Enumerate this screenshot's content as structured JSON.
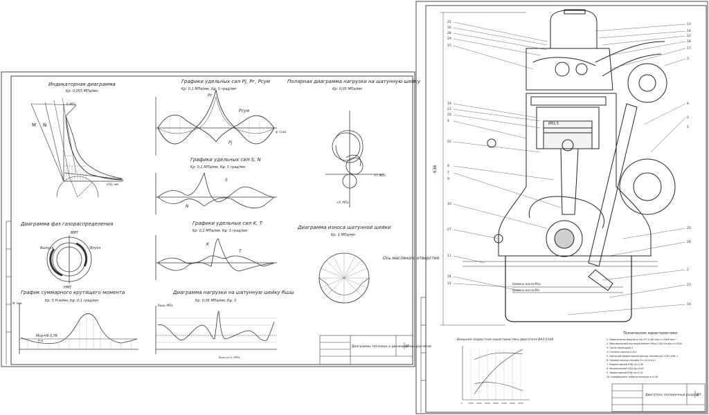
{
  "left_sheet": {
    "titles": {
      "indicator": "Индикаторная диаграмма",
      "forces_pj": "Графики удельных сил Pj, Pг, Pсум",
      "polar": "Полярная диаграмма нагрузки на шатунную шейку",
      "forces_sn": "Графики удельных сил S, N",
      "valve_timing": "Диаграмма фаз газораспределения",
      "forces_kt": "Графики удельных сил K, T",
      "wear": "Диаграмма износа шатунной шейки",
      "torque": "График суммарного крутящего момента",
      "rsh": "Диаграмма нагрузки на шатунную шейку Rшш"
    },
    "scales": {
      "indicator": "Kp: 0,055 МПа/мм",
      "forces_pj": "Kp: 0,1 МПа/мм, Kφ: 3 град/мм",
      "polar": "Kp: 0,05 МПа/мм",
      "forces_sn": "Kp: 0,1 МПа/мм, Kφ: 3 град/мм",
      "forces_kt": "Kp: 0,1 МПа/мм, Kφ: 3 град/мм",
      "wear": "Kp: 1 МПа/мм",
      "torque": "Kp: 5 Н·м/мм, Kφ: 0,1 град/мм",
      "rsh": "Kp: 0,05 МПа/мм, Kφ: 3"
    },
    "labels": {
      "m": "M",
      "n": "N",
      "p_mpa": "P, МПа",
      "v_cm": "V(S), мм",
      "pg": "Pг",
      "psum": "Pсум",
      "pj": "Pj",
      "phi_deg": "φ, град",
      "s": "S",
      "n2": "N",
      "k": "K",
      "t": "T",
      "vmt": "ВМТ",
      "nmt": "НМТ",
      "exhaust": "Выпуск",
      "intake": "Впуск",
      "mcr": "Mср=N·3,76",
      "nm": "Н·м",
      "axis_m": "M, Н·м",
      "oil_hole": "Ось масляного отверстия",
      "polar_t": "+T, МПа",
      "polar_k": "+K, МПа",
      "rsh_axis": "Rшш, МПа",
      "rsh_mean": "Rшш.ср=2,7МПа"
    },
    "stamp": {
      "title": "Диаграммы тепловых и динамических расчетов",
      "sheet": "ДП"
    }
  },
  "right_sheet": {
    "dimension": "636",
    "dimension_small": "Ø91,5",
    "graph_title": "Внешняя скоростная характеристика двигателя ВАЗ-2106",
    "spec_title": "Технические характеристики",
    "specs": [
      "1. Номинальная мощность Nе=57,4 кВт при n=5600 мин⁻¹",
      "2. Максимальный крутящий момент Мкр=116 Н·м при n=3400",
      "3. Число цилиндров 4",
      "4. Степень сжатия ε=8,5",
      "5. Удельный эффективный расход топлива gе=256 г/кВт·ч",
      "6. Часовой расход топлива Gт=14,6 кг/ч",
      "7. Индикаторный КПД ηi=0,38",
      "8. Механический КПД ηм=0,83",
      "9. Эффективный КПД ηе=0,32",
      "10. Коэффициент избытка воздуха α=0,95"
    ],
    "oil_level_max": "Уровень масла Max",
    "oil_level_min": "Уровень масла Min",
    "stamp": {
      "title": "Двигатель (поперечный разрез)",
      "sheet": "ДП"
    },
    "callouts_left": [
      "25",
      "30",
      "28",
      "29",
      "15",
      "19",
      "21",
      "20",
      "4",
      "22",
      "8",
      "7",
      "9",
      "10",
      "27",
      "11",
      "24",
      "31"
    ],
    "callouts_right": [
      "13",
      "14",
      "12",
      "18",
      "17",
      "3",
      "6",
      "1",
      "5",
      "25",
      "26",
      "2",
      "23",
      "16"
    ],
    "axis_ticks": [
      "0",
      "1500",
      "2000",
      "2500",
      "3000",
      "3500",
      "4000",
      "4500"
    ]
  }
}
